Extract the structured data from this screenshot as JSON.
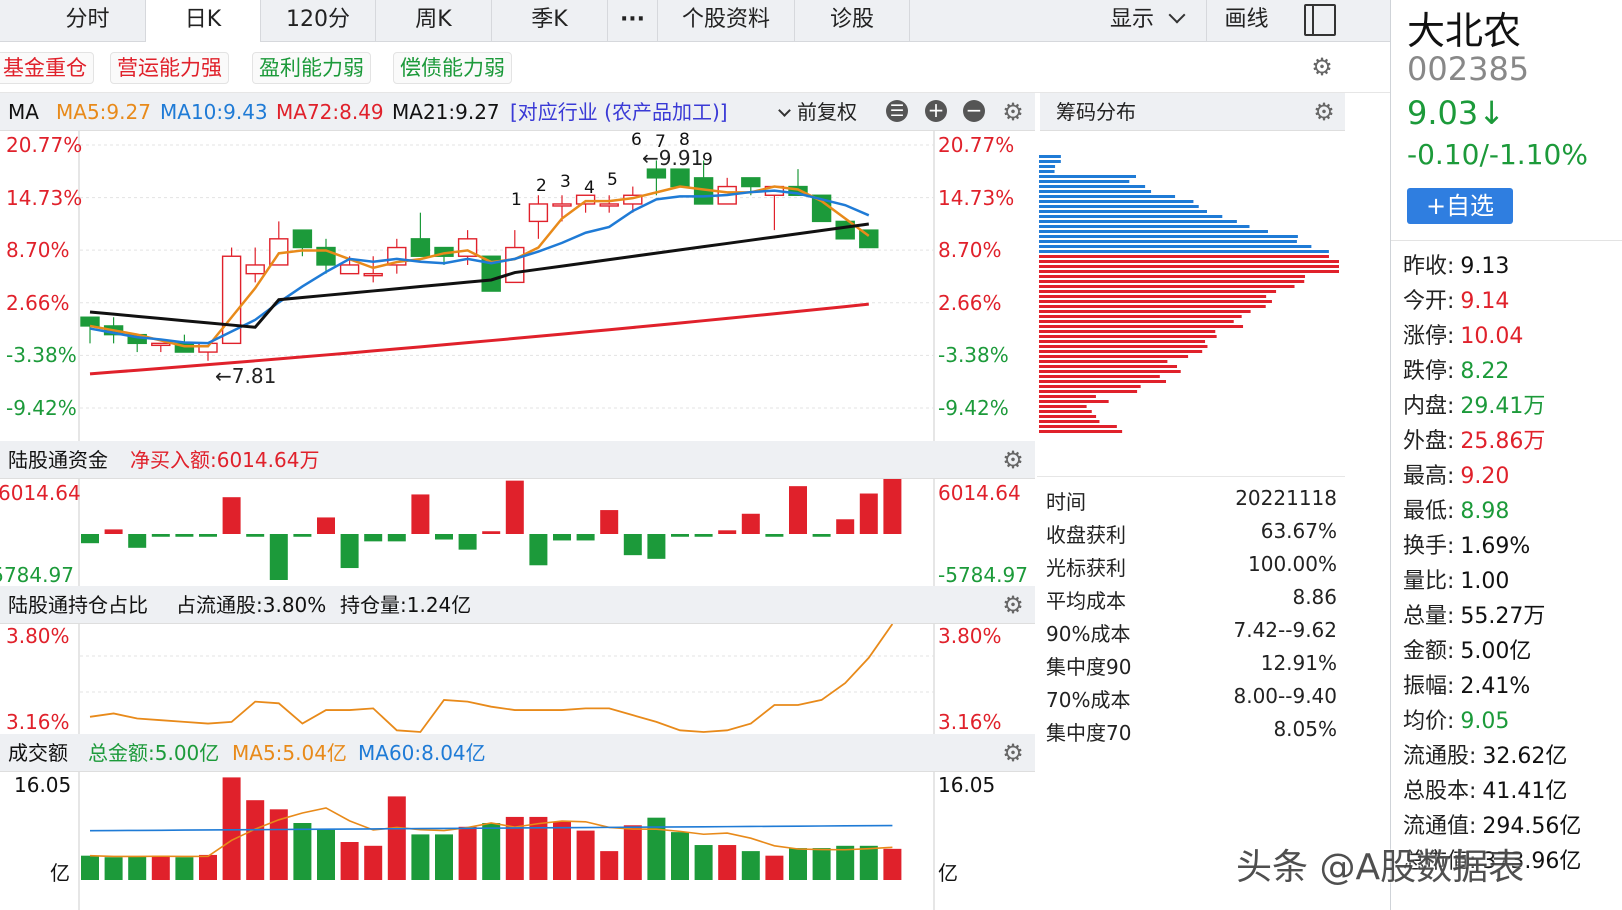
{
  "tabs": [
    "分时",
    "日K",
    "120分",
    "周K",
    "季K",
    "···",
    "个股资料",
    "诊股"
  ],
  "tabs_right": {
    "display": "显示",
    "draw": "画线"
  },
  "tags": [
    "基金重仓",
    "营运能力强",
    "盈利能力弱",
    "偿债能力弱"
  ],
  "ma_bar": {
    "label": "MA",
    "ma5": "MA5:9.27",
    "ma10": "MA10:9.43",
    "ma72": "MA72:8.49",
    "ma21": "MA21:9.27",
    "industry": "[对应行业 (农产品加工)]",
    "adjust": "前复权"
  },
  "main_axis": [
    "20.77%",
    "14.73%",
    "8.70%",
    "2.66%",
    "-3.38%",
    "-9.42%"
  ],
  "main_annotations": {
    "low": "←7.81",
    "high": "←9.91",
    "numbers": [
      "1",
      "2",
      "3",
      "4",
      "5",
      "6",
      "7",
      "8",
      "9"
    ]
  },
  "chip": {
    "title": "筹码分布",
    "rows": [
      {
        "k": "时间",
        "v": "20221118"
      },
      {
        "k": "收盘获利",
        "v": "63.67%"
      },
      {
        "k": "光标获利",
        "v": "100.00%"
      },
      {
        "k": "平均成本",
        "v": "8.86"
      },
      {
        "k": "90%成本",
        "v": "7.42--9.62"
      },
      {
        "k": "集中度90",
        "v": "12.91%"
      },
      {
        "k": "70%成本",
        "v": "8.00--9.40"
      },
      {
        "k": "集中度70",
        "v": "8.05%"
      }
    ]
  },
  "panel2": {
    "title": "陆股通资金",
    "net": "净买入额:6014.64万",
    "top": "6014.64",
    "bottom": "-5784.97",
    "left_bottom": "-5784.97"
  },
  "panel3": {
    "title": "陆股通持仓占比",
    "ratio": "占流通股:3.80%",
    "holding": "持仓量:1.24亿",
    "top": "3.80%",
    "bottom": "3.16%"
  },
  "panel4": {
    "title": "成交额",
    "total": "总金额:5.00亿",
    "ma5": "MA5:5.04亿",
    "ma60": "MA60:8.04亿",
    "top": "16.05",
    "unit": "亿"
  },
  "stock": {
    "name": "大北农",
    "code": "002385",
    "price": "9.03↓",
    "change": "-0.10/-1.10%",
    "add": "+自选"
  },
  "quote": [
    {
      "k": "昨收:",
      "v": "9.13",
      "c": "black"
    },
    {
      "k": "今开:",
      "v": "9.14",
      "c": "red"
    },
    {
      "k": "涨停:",
      "v": "10.04",
      "c": "red"
    },
    {
      "k": "跌停:",
      "v": "8.22",
      "c": "green"
    },
    {
      "k": "内盘:",
      "v": "29.41万",
      "c": "green"
    },
    {
      "k": "外盘:",
      "v": "25.86万",
      "c": "red"
    },
    {
      "k": "最高:",
      "v": "9.20",
      "c": "red"
    },
    {
      "k": "最低:",
      "v": "8.98",
      "c": "green"
    },
    {
      "k": "换手:",
      "v": "1.69%",
      "c": "black"
    },
    {
      "k": "量比:",
      "v": "1.00",
      "c": "black"
    },
    {
      "k": "总量:",
      "v": "55.27万",
      "c": "black"
    },
    {
      "k": "金额:",
      "v": "5.00亿",
      "c": "black"
    },
    {
      "k": "振幅:",
      "v": "2.41%",
      "c": "black"
    },
    {
      "k": "均价:",
      "v": "9.05",
      "c": "green"
    },
    {
      "k": "流通股:",
      "v": "32.62亿",
      "c": "black"
    },
    {
      "k": "总股本:",
      "v": "41.41亿",
      "c": "black"
    },
    {
      "k": "流通值:",
      "v": "294.56亿",
      "c": "black"
    },
    {
      "k": "总市值:",
      "v": "373.96亿",
      "c": "black"
    }
  ],
  "watermark": "头条 @A股数据表",
  "colors": {
    "up": "#e0212b",
    "down": "#1c9a3a",
    "ma5": "#e88a1a",
    "ma10": "#1f7bd6",
    "ma21": "#111111",
    "ma72": "#e0212b"
  },
  "chart_data": {
    "type": "candlestick",
    "y_axis_ticks_pct": [
      "20.77%",
      "14.73%",
      "8.70%",
      "2.66%",
      "-3.38%",
      "-9.42%"
    ],
    "candles_pct": [
      [
        1,
        1,
        -2,
        0
      ],
      [
        0,
        1,
        -2,
        -1
      ],
      [
        -1,
        -1,
        -3,
        -2
      ],
      [
        -2,
        -2,
        -3,
        -2
      ],
      [
        -2,
        -1,
        -3,
        -3
      ],
      [
        -3,
        -3,
        -4,
        -2
      ],
      [
        -2,
        9,
        -2,
        8
      ],
      [
        6,
        9,
        5,
        7
      ],
      [
        7,
        12,
        7,
        10
      ],
      [
        11,
        11,
        8,
        9
      ],
      [
        9,
        10,
        6,
        7
      ],
      [
        6,
        8,
        6,
        7
      ],
      [
        6,
        8,
        5,
        6
      ],
      [
        7,
        10,
        6,
        9
      ],
      [
        10,
        13,
        8,
        8
      ],
      [
        9,
        9,
        7,
        8
      ],
      [
        8,
        11,
        7,
        10
      ],
      [
        8,
        8,
        4,
        4
      ],
      [
        5,
        11,
        5,
        9
      ],
      [
        12,
        15,
        10,
        14
      ],
      [
        14,
        15,
        12,
        14
      ],
      [
        14,
        15,
        13,
        15
      ],
      [
        14,
        15,
        13,
        14
      ],
      [
        14,
        16,
        13,
        15
      ],
      [
        18,
        19,
        15,
        17
      ],
      [
        18,
        18,
        16,
        16
      ],
      [
        17,
        19,
        14,
        14
      ],
      [
        14,
        17,
        14,
        16
      ],
      [
        17,
        17,
        15,
        16
      ],
      [
        15,
        16,
        11,
        16
      ],
      [
        16,
        18,
        15,
        15
      ],
      [
        15,
        15,
        12,
        12
      ],
      [
        12,
        12,
        10,
        10
      ],
      [
        11,
        11,
        9,
        9
      ]
    ],
    "series": [
      {
        "name": "MA5"
      },
      {
        "name": "MA10"
      },
      {
        "name": "MA21"
      },
      {
        "name": "MA72"
      }
    ],
    "flow": [
      -1,
      0.5,
      -1.5,
      -0.3,
      -0.3,
      -0.3,
      4,
      -0.3,
      -5,
      -0.3,
      1.8,
      -3.7,
      -0.8,
      -0.8,
      4.3,
      -0.6,
      -1.7,
      0.3,
      5.8,
      -3.4,
      -0.7,
      -0.7,
      2.6,
      -2.3,
      -2.7,
      -0.3,
      -0.3,
      0.4,
      2.2,
      -0.3,
      5.2,
      -0.3,
      1.6,
      4.4,
      6.0
    ],
    "holding_ratio": [
      3.25,
      3.27,
      3.24,
      3.23,
      3.22,
      3.21,
      3.22,
      3.34,
      3.33,
      3.21,
      3.29,
      3.29,
      3.3,
      3.17,
      3.16,
      3.35,
      3.34,
      3.31,
      3.29,
      3.29,
      3.29,
      3.3,
      3.3,
      3.26,
      3.22,
      3.17,
      3.16,
      3.17,
      3.21,
      3.32,
      3.32,
      3.35,
      3.45,
      3.6,
      3.8
    ],
    "turnover": [
      3.2,
      3.0,
      3.1,
      3.2,
      3.0,
      3.3,
      13.5,
      10.5,
      9.3,
      7.5,
      6.6,
      5.0,
      4.5,
      11.0,
      6.0,
      6.0,
      7.0,
      7.5,
      8.3,
      8.3,
      7.7,
      6.5,
      3.8,
      7.2,
      8.2,
      6.3,
      4.6,
      4.6,
      3.8,
      3.2,
      4.2,
      4.2,
      4.5,
      4.5,
      4.1
    ]
  }
}
